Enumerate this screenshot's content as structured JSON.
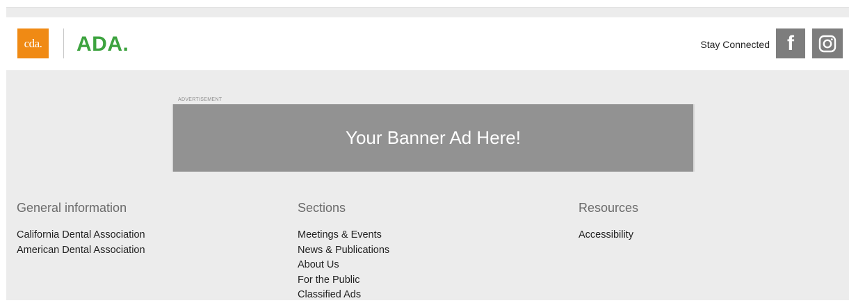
{
  "header": {
    "cda_logo_text": "cda.",
    "ada_logo_text": "ADA.",
    "stay_connected_label": "Stay Connected",
    "facebook_glyph": "f"
  },
  "ad": {
    "label": "ADVERTISEMENT",
    "banner_text": "Your Banner Ad Here!"
  },
  "footer": {
    "columns": [
      {
        "heading": "General information",
        "links": [
          "California Dental Association",
          "American Dental Association"
        ]
      },
      {
        "heading": "Sections",
        "links": [
          "Meetings & Events",
          "News & Publications",
          "About Us",
          "For the Public",
          "Classified Ads"
        ]
      },
      {
        "heading": "Resources",
        "links": [
          "Accessibility"
        ]
      }
    ]
  },
  "colors": {
    "cda_orange": "#f08a14",
    "ada_green": "#3da33f",
    "social_gray": "#7d7d7d",
    "banner_gray": "#929292",
    "footer_bg": "#ececec"
  },
  "icons": {
    "facebook": "facebook-icon",
    "instagram": "instagram-icon"
  }
}
